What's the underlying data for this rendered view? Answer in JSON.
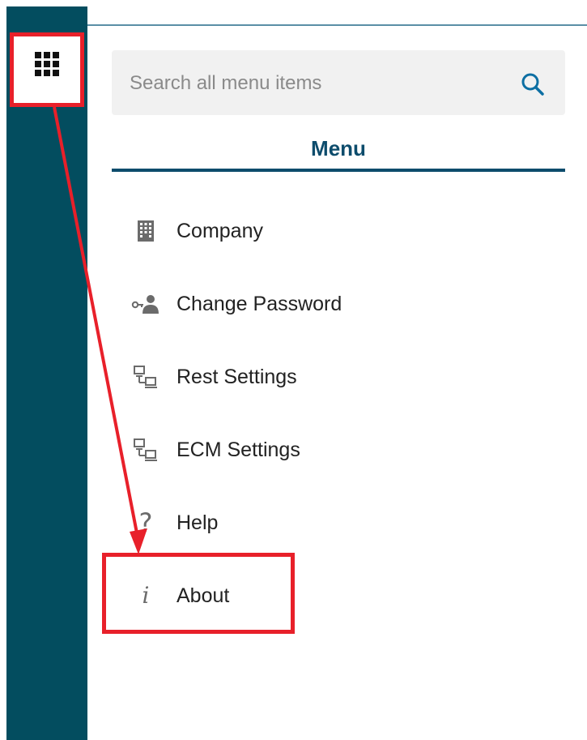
{
  "search": {
    "placeholder": "Search all menu items",
    "icon": "search-icon"
  },
  "menu": {
    "title": "Menu",
    "items": [
      {
        "label": "Company",
        "icon": "building-icon"
      },
      {
        "label": "Change Password",
        "icon": "user-key-icon"
      },
      {
        "label": "Rest Settings",
        "icon": "network-icon"
      },
      {
        "label": "ECM Settings",
        "icon": "network-icon"
      },
      {
        "label": "Help",
        "icon": "question-icon"
      },
      {
        "label": "About",
        "icon": "info-icon"
      }
    ]
  },
  "colors": {
    "rail": "#034d5f",
    "accent": "#0d4c6c",
    "annotation": "#e8202a",
    "search_bg": "#f1f1f1"
  }
}
